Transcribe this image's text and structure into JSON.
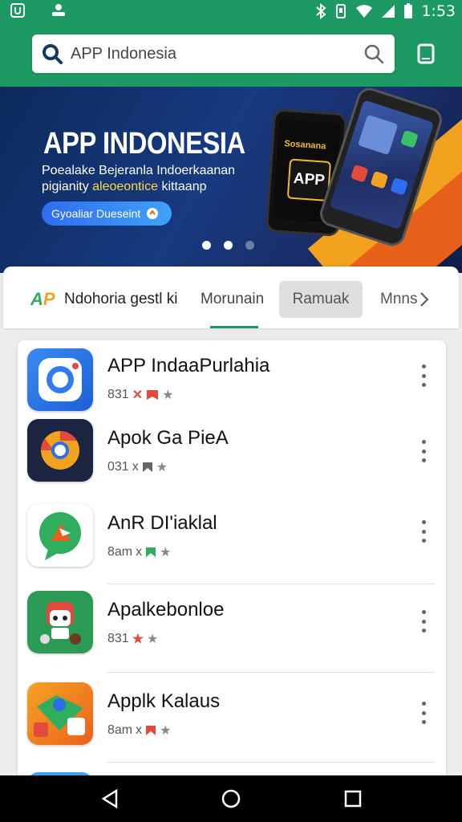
{
  "status_bar": {
    "time": "1:53"
  },
  "search": {
    "text": "APP Indonesia"
  },
  "banner": {
    "title": "APP INDONESIA",
    "subtitle_line1": "Poealake Bejeranla Indoerkaanan",
    "subtitle_line2_prefix": "pigianity",
    "subtitle_line2_highlight": "aleoeontice",
    "subtitle_line2_suffix": "kittaanp",
    "cta_label": "Gyoaliar Dueseint",
    "phone_brand": "Sosanana",
    "phone_badge": "APP",
    "carousel_pages": 3,
    "carousel_active": 2
  },
  "tabs": {
    "logo_a": "A",
    "logo_p": "P",
    "brand_label": "Ndohoria gestl ki",
    "items": [
      "Morunain",
      "Ramuak",
      "Mnns"
    ]
  },
  "apps": [
    {
      "name": "APP IndaaPurlahia",
      "meta": "831"
    },
    {
      "name": "Apok Ga PieA",
      "meta": "031"
    },
    {
      "name": "AnR DI'iaklal",
      "meta": "8am"
    },
    {
      "name": "Apalkebonloe",
      "meta": "831"
    },
    {
      "name": "Applk Kalaus",
      "meta": "8am"
    }
  ],
  "colors": {
    "brand_green": "#1d9a63",
    "banner_navy": "#173a80",
    "accent_orange": "#f3a21f"
  }
}
